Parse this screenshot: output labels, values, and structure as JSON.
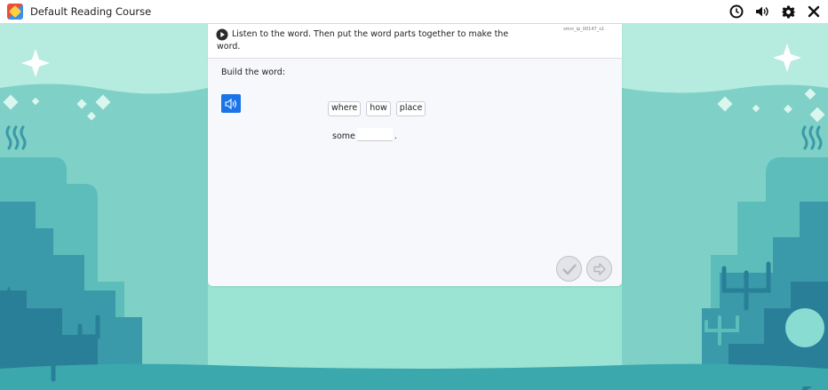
{
  "app": {
    "title": "Default Reading Course"
  },
  "toolbar": {
    "icons": [
      "clock-icon",
      "volume-icon",
      "gear-icon",
      "close-icon"
    ]
  },
  "activity": {
    "item_id": "smrc_ip_00147_s1",
    "instruction": "Listen to the word. Then put the word parts together to make the word.",
    "build_label": "Build the word:",
    "word_parts": [
      "where",
      "how",
      "place"
    ],
    "answer_prefix": "some",
    "answer_suffix": "."
  },
  "colors": {
    "accent": "#1a73e8",
    "background": "#9be3d3",
    "card": "#f7f8fc"
  }
}
